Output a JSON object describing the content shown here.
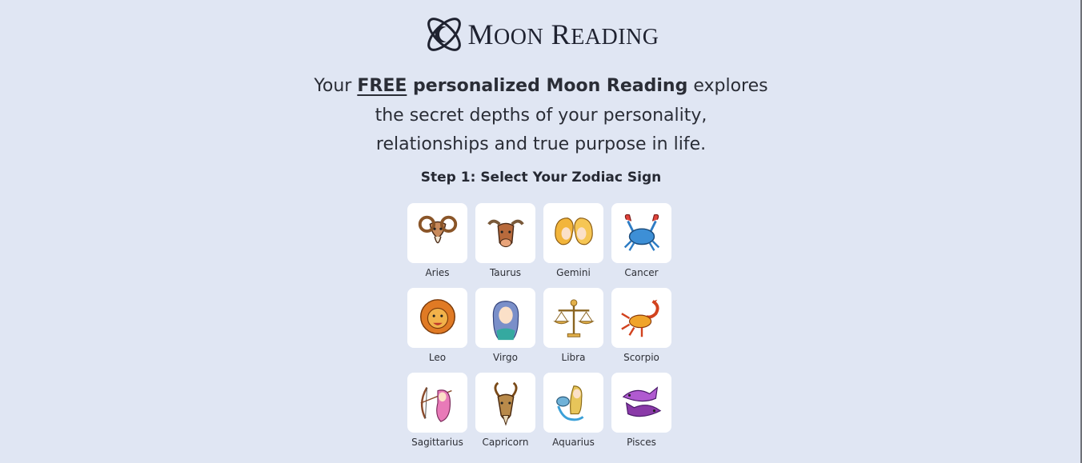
{
  "logo": {
    "text_big_1": "M",
    "text_small_1": "OON",
    "text_big_2": "R",
    "text_small_2": "EADING",
    "icon": "moon-orbit-logo-icon"
  },
  "intro": {
    "part1": "Your ",
    "free": "FREE",
    "bold": " personalized Moon Reading",
    "part2": " explores",
    "line2": "the secret depths of your personality,",
    "line3": "relationships and true purpose in life."
  },
  "step": {
    "title": "Step 1: Select Your Zodiac Sign"
  },
  "zodiac": [
    {
      "label": "Aries",
      "icon": "ram-icon"
    },
    {
      "label": "Taurus",
      "icon": "bull-icon"
    },
    {
      "label": "Gemini",
      "icon": "twins-icon"
    },
    {
      "label": "Cancer",
      "icon": "crab-icon"
    },
    {
      "label": "Leo",
      "icon": "lion-icon"
    },
    {
      "label": "Virgo",
      "icon": "maiden-icon"
    },
    {
      "label": "Libra",
      "icon": "scales-icon"
    },
    {
      "label": "Scorpio",
      "icon": "scorpion-icon"
    },
    {
      "label": "Sagittarius",
      "icon": "archer-icon"
    },
    {
      "label": "Capricorn",
      "icon": "goat-icon"
    },
    {
      "label": "Aquarius",
      "icon": "water-bearer-icon"
    },
    {
      "label": "Pisces",
      "icon": "fish-icon"
    }
  ],
  "colors": {
    "background": "#e0e6f3",
    "card": "#ffffff",
    "text": "#2a2d36"
  }
}
